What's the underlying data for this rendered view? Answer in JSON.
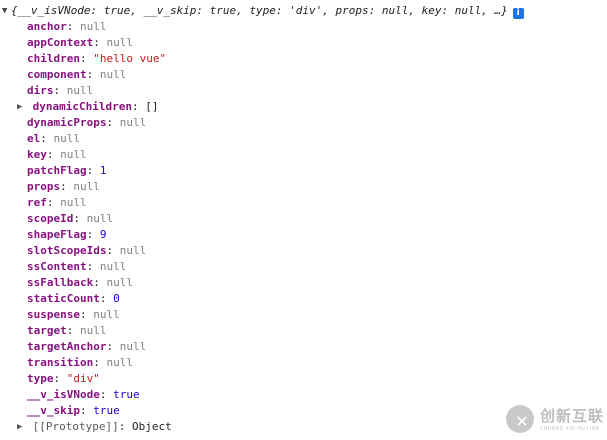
{
  "console": {
    "summary": {
      "arrow": "▼",
      "text": "{__v_isVNode: true, __v_skip: true, type: 'div', props: null, key: null, …}",
      "info_icon": "i"
    },
    "properties": [
      {
        "key": "anchor",
        "value": "null",
        "kind": "null"
      },
      {
        "key": "appContext",
        "value": "null",
        "kind": "null"
      },
      {
        "key": "children",
        "value": "\"hello vue\"",
        "kind": "str"
      },
      {
        "key": "component",
        "value": "null",
        "kind": "null"
      },
      {
        "key": "dirs",
        "value": "null",
        "kind": "null"
      },
      {
        "key": "dynamicChildren",
        "value": "[]",
        "kind": "obj",
        "expandable": true
      },
      {
        "key": "dynamicProps",
        "value": "null",
        "kind": "null"
      },
      {
        "key": "el",
        "value": "null",
        "kind": "null"
      },
      {
        "key": "key",
        "value": "null",
        "kind": "null"
      },
      {
        "key": "patchFlag",
        "value": "1",
        "kind": "num"
      },
      {
        "key": "props",
        "value": "null",
        "kind": "null"
      },
      {
        "key": "ref",
        "value": "null",
        "kind": "null"
      },
      {
        "key": "scopeId",
        "value": "null",
        "kind": "null"
      },
      {
        "key": "shapeFlag",
        "value": "9",
        "kind": "num"
      },
      {
        "key": "slotScopeIds",
        "value": "null",
        "kind": "null"
      },
      {
        "key": "ssContent",
        "value": "null",
        "kind": "null"
      },
      {
        "key": "ssFallback",
        "value": "null",
        "kind": "null"
      },
      {
        "key": "staticCount",
        "value": "0",
        "kind": "num"
      },
      {
        "key": "suspense",
        "value": "null",
        "kind": "null"
      },
      {
        "key": "target",
        "value": "null",
        "kind": "null"
      },
      {
        "key": "targetAnchor",
        "value": "null",
        "kind": "null"
      },
      {
        "key": "transition",
        "value": "null",
        "kind": "null"
      },
      {
        "key": "type",
        "value": "\"div\"",
        "kind": "str"
      },
      {
        "key": "__v_isVNode",
        "value": "true",
        "kind": "bool"
      },
      {
        "key": "__v_skip",
        "value": "true",
        "kind": "bool"
      },
      {
        "key": "[[Prototype]]",
        "value": "Object",
        "kind": "obj",
        "expandable": true,
        "inner": true
      }
    ]
  },
  "watermark": {
    "glyph": "✕",
    "title": "创新互联",
    "subtitle": "CHUANG XIN HU LIAN"
  },
  "colors": {
    "key": "#881280",
    "null": "#808080",
    "string": "#c41a16",
    "number": "#1c00cf",
    "info_icon": "#1a73e8"
  }
}
